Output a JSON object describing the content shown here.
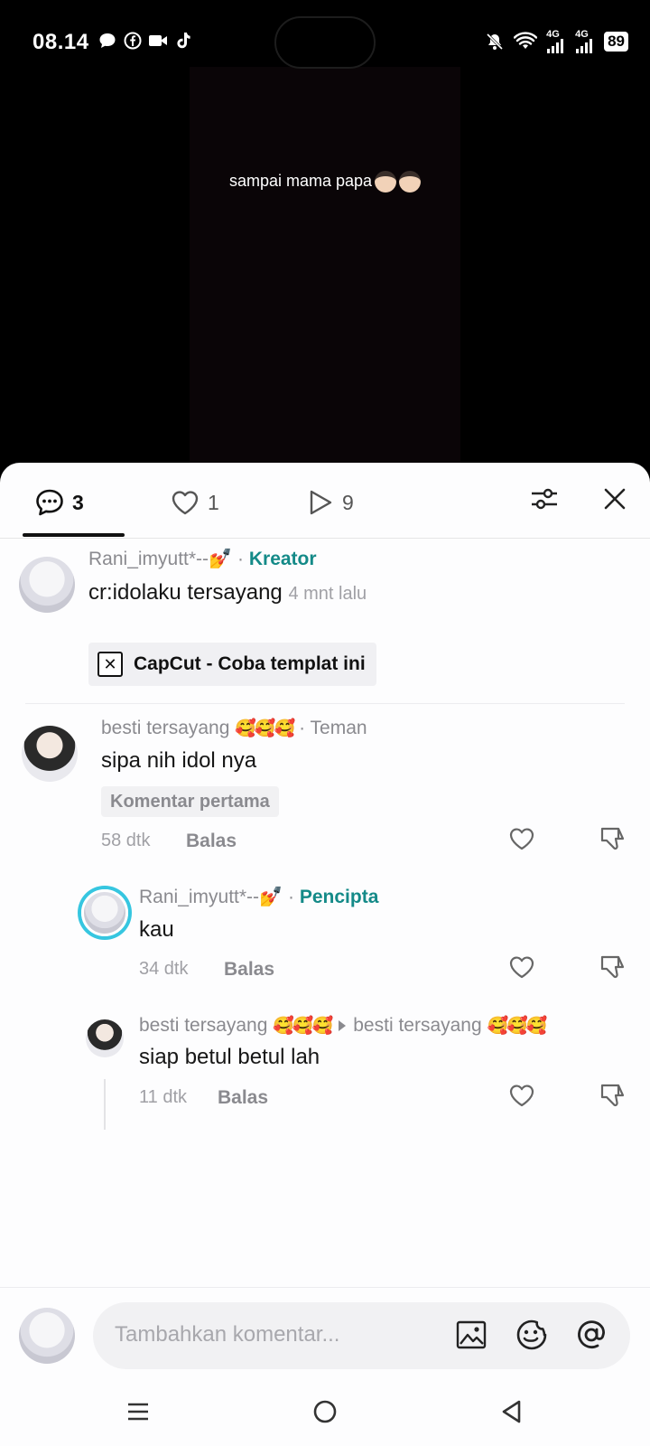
{
  "status_bar": {
    "time": "08.14",
    "battery": "89",
    "network_1": "4G",
    "network_2": "4G"
  },
  "video": {
    "caption": "sampai mama papa"
  },
  "tabs": {
    "comments_count": "3",
    "likes_count": "1",
    "views_count": "9"
  },
  "creator_comment": {
    "username": "Rani_imyutt*--💅",
    "role": "Kreator",
    "text": "cr:idolaku tersayang",
    "time": "4 mnt lalu",
    "chip_label": "CapCut - Coba templat ini"
  },
  "comments": [
    {
      "username": "besti tersayang",
      "emojis": "🥰🥰🥰",
      "role": "Teman",
      "text": "sipa nih idol nya",
      "badge": "Komentar pertama",
      "time": "58 dtk",
      "reply_label": "Balas"
    },
    {
      "username": "Rani_imyutt*--💅",
      "role": "Pencipta",
      "text": "kau",
      "time": "34 dtk",
      "reply_label": "Balas"
    },
    {
      "username": "besti tersayang",
      "emojis": "🥰🥰🥰",
      "reply_to": "besti tersayang",
      "reply_to_emojis": "🥰🥰🥰",
      "text": "siap betul betul lah",
      "time": "11 dtk",
      "reply_label": "Balas"
    }
  ],
  "input": {
    "placeholder": "Tambahkan komentar..."
  },
  "colors": {
    "role_accent": "#148a88",
    "avatar_ring": "#36c6e0"
  }
}
